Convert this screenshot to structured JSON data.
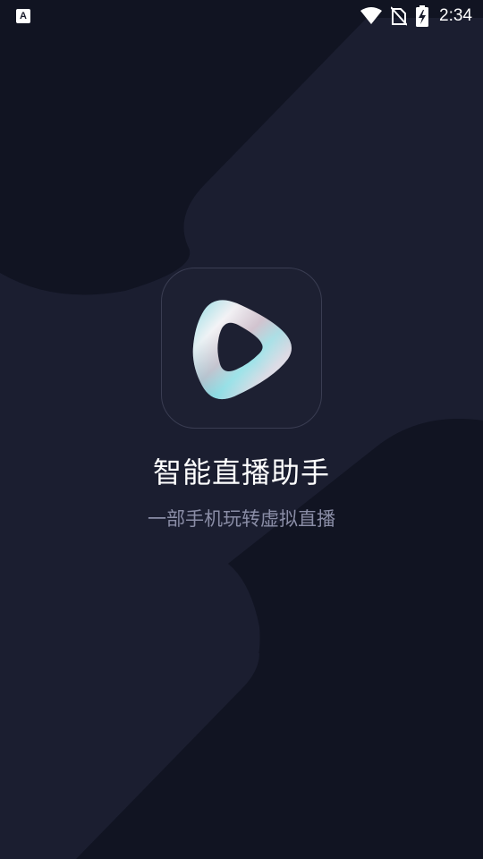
{
  "status_bar": {
    "left_icon_letter": "A",
    "left_icon": "accessibility-a-icon",
    "icons": [
      "wifi-icon",
      "no-sim-icon",
      "battery-charging-icon"
    ],
    "time": "2:34"
  },
  "splash": {
    "app_icon": "play-logo-icon",
    "title": "智能直播助手",
    "subtitle": "一部手机玩转虚拟直播"
  },
  "colors": {
    "background": "#181b2b",
    "dark_shape": "#111422",
    "light_shape": "#1d2033",
    "title": "#ffffff",
    "subtitle": "#8a8da6"
  }
}
